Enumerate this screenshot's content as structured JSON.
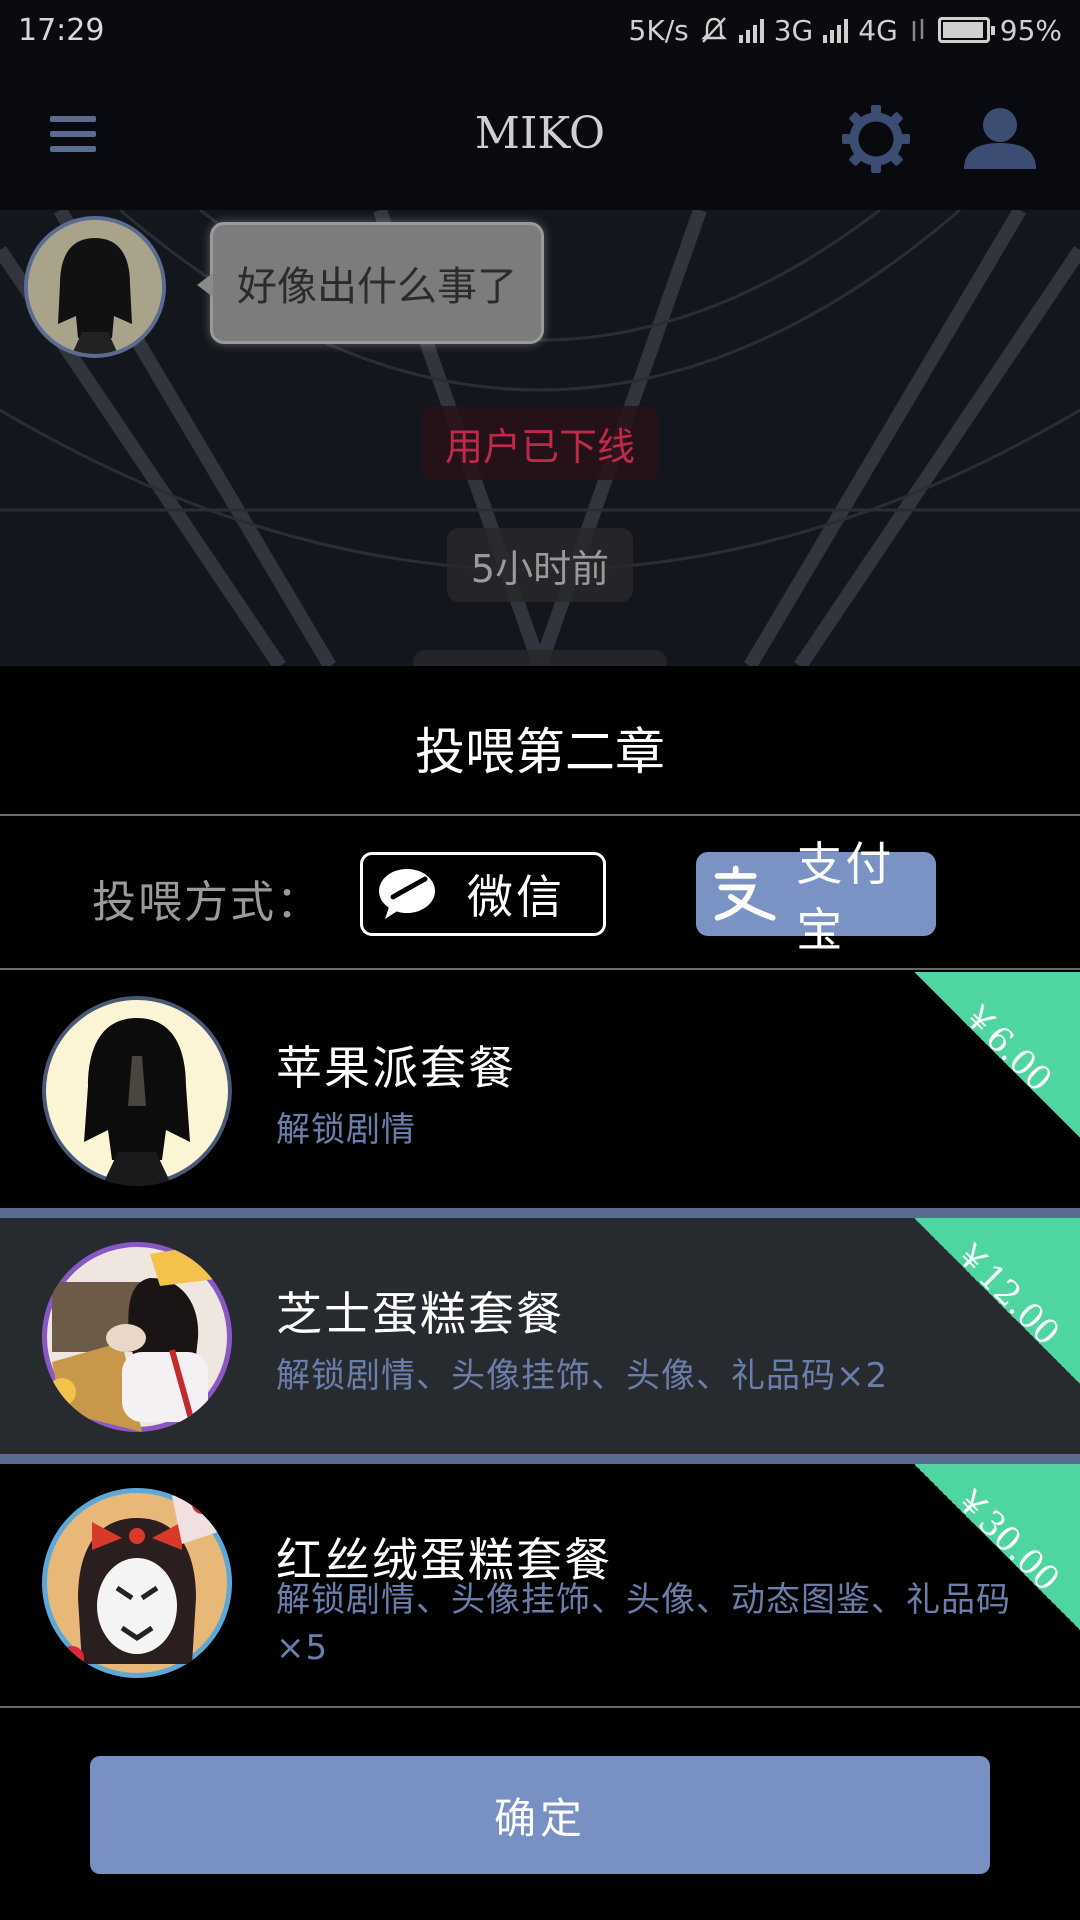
{
  "status_bar": {
    "time": "17:29",
    "speed": "5K/s",
    "net_3g": "3G",
    "net_4g": "4G",
    "battery_percent_text": "95%",
    "battery_level": 0.95
  },
  "app_bar": {
    "title": "MIKO",
    "icons": [
      "menu-icon",
      "gear-icon",
      "user-icon"
    ]
  },
  "chat": {
    "message": "好像出什么事了",
    "status_offline": "用户已下线",
    "timestamp": "5小时前"
  },
  "sheet": {
    "title": "投喂第二章",
    "pay_label": "投喂方式：",
    "pay_methods": [
      {
        "label": "微信",
        "icon": "wechat-icon",
        "selected": false
      },
      {
        "label": "支付宝",
        "icon": "alipay-icon",
        "selected": true
      }
    ],
    "packages": [
      {
        "name": "苹果派套餐",
        "desc": "解锁剧情",
        "price": "￥6.00",
        "selected": false
      },
      {
        "name": "芝士蛋糕套餐",
        "desc": "解锁剧情、头像挂饰、头像、礼品码×2",
        "price": "￥12.00",
        "selected": true
      },
      {
        "name": "红丝绒蛋糕套餐",
        "desc": "解锁剧情、头像挂饰、头像、动态图鉴、礼品码×5",
        "price": "￥30.00",
        "selected": false
      }
    ],
    "confirm_label": "确定"
  },
  "colors": {
    "accent_blue": "#7890c2",
    "price_green": "#4fd6a0",
    "offline_red": "#c0294a"
  }
}
